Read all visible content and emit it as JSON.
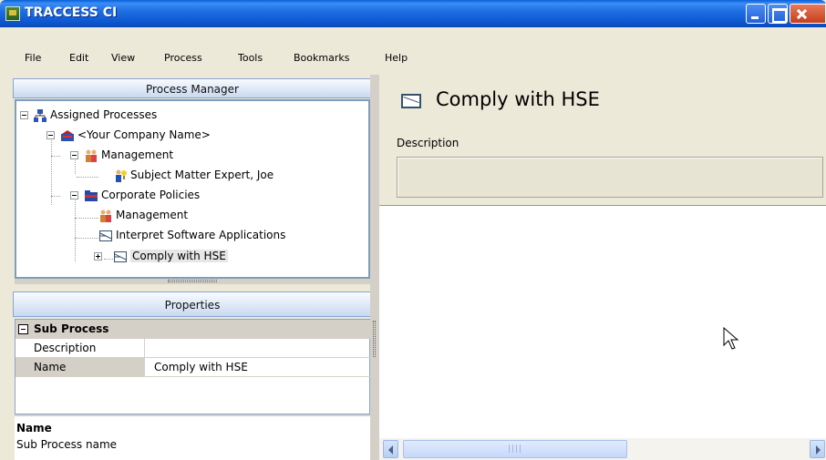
{
  "window": {
    "title": "TRACCESS CI"
  },
  "menu": [
    "File",
    "Edit",
    "View",
    "Process",
    "Tools",
    "Bookmarks",
    "Help"
  ],
  "process_manager": {
    "header": "Process Manager",
    "tree": [
      {
        "label": "Assigned Processes",
        "icon": "org-chart-icon"
      },
      {
        "label": "<Your Company Name>",
        "icon": "company-icon"
      },
      {
        "label": "Management",
        "icon": "people-icon"
      },
      {
        "label": "Subject Matter Expert, Joe",
        "icon": "person-icon"
      },
      {
        "label": "Corporate Policies",
        "icon": "folder-icon"
      },
      {
        "label": "Management",
        "icon": "people-icon"
      },
      {
        "label": "Interpret Software Applications",
        "icon": "document-icon"
      },
      {
        "label": "Comply with HSE",
        "icon": "document-icon",
        "selected": true
      }
    ]
  },
  "properties": {
    "header": "Properties",
    "group": "Sub Process",
    "rows": [
      {
        "key": "Description",
        "value": ""
      },
      {
        "key": "Name",
        "value": "Comply with HSE"
      }
    ],
    "help_title": "Name",
    "help_desc": "Sub Process name"
  },
  "detail": {
    "title": "Comply with HSE",
    "description_label": "Description",
    "description_value": ""
  }
}
